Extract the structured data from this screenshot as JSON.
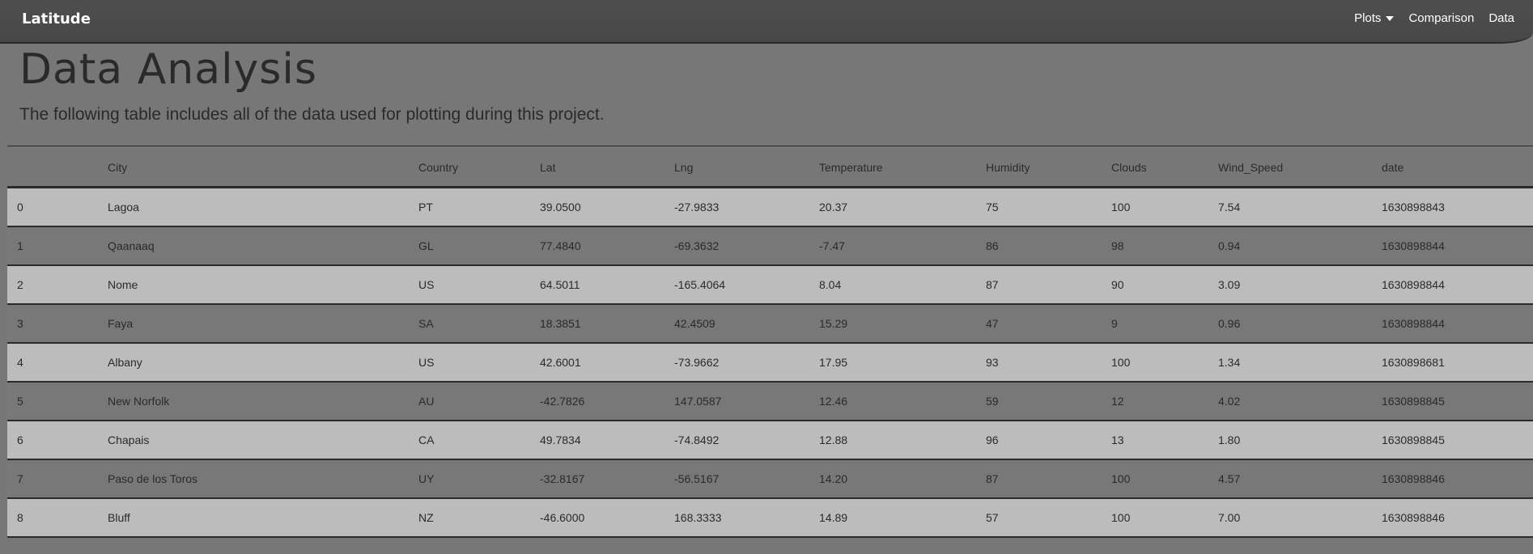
{
  "navbar": {
    "brand": "Latitude",
    "items": [
      {
        "label": "Plots",
        "dropdown": true
      },
      {
        "label": "Comparison"
      },
      {
        "label": "Data"
      }
    ]
  },
  "page": {
    "title": "Data Analysis",
    "subtitle": "The following table includes all of the data used for plotting during this project."
  },
  "table": {
    "columns": [
      "",
      "City",
      "Country",
      "Lat",
      "Lng",
      "Temperature",
      "Humidity",
      "Clouds",
      "Wind_Speed",
      "date"
    ],
    "rows": [
      [
        "0",
        "Lagoa",
        "PT",
        "39.0500",
        "-27.9833",
        "20.37",
        "75",
        "100",
        "7.54",
        "1630898843"
      ],
      [
        "1",
        "Qaanaaq",
        "GL",
        "77.4840",
        "-69.3632",
        "-7.47",
        "86",
        "98",
        "0.94",
        "1630898844"
      ],
      [
        "2",
        "Nome",
        "US",
        "64.5011",
        "-165.4064",
        "8.04",
        "87",
        "90",
        "3.09",
        "1630898844"
      ],
      [
        "3",
        "Faya",
        "SA",
        "18.3851",
        "42.4509",
        "15.29",
        "47",
        "9",
        "0.96",
        "1630898844"
      ],
      [
        "4",
        "Albany",
        "US",
        "42.6001",
        "-73.9662",
        "17.95",
        "93",
        "100",
        "1.34",
        "1630898681"
      ],
      [
        "5",
        "New Norfolk",
        "AU",
        "-42.7826",
        "147.0587",
        "12.46",
        "59",
        "12",
        "4.02",
        "1630898845"
      ],
      [
        "6",
        "Chapais",
        "CA",
        "49.7834",
        "-74.8492",
        "12.88",
        "96",
        "13",
        "1.80",
        "1630898845"
      ],
      [
        "7",
        "Paso de los Toros",
        "UY",
        "-32.8167",
        "-56.5167",
        "14.20",
        "87",
        "100",
        "4.57",
        "1630898846"
      ],
      [
        "8",
        "Bluff",
        "NZ",
        "-46.6000",
        "168.3333",
        "14.89",
        "57",
        "100",
        "7.00",
        "1630898846"
      ]
    ]
  },
  "colors": {
    "navbar": "#4a4a4a",
    "background": "#777777",
    "row_light": "#bcbcbc",
    "row_dark": "#787878",
    "text": "#2a2a2a"
  }
}
